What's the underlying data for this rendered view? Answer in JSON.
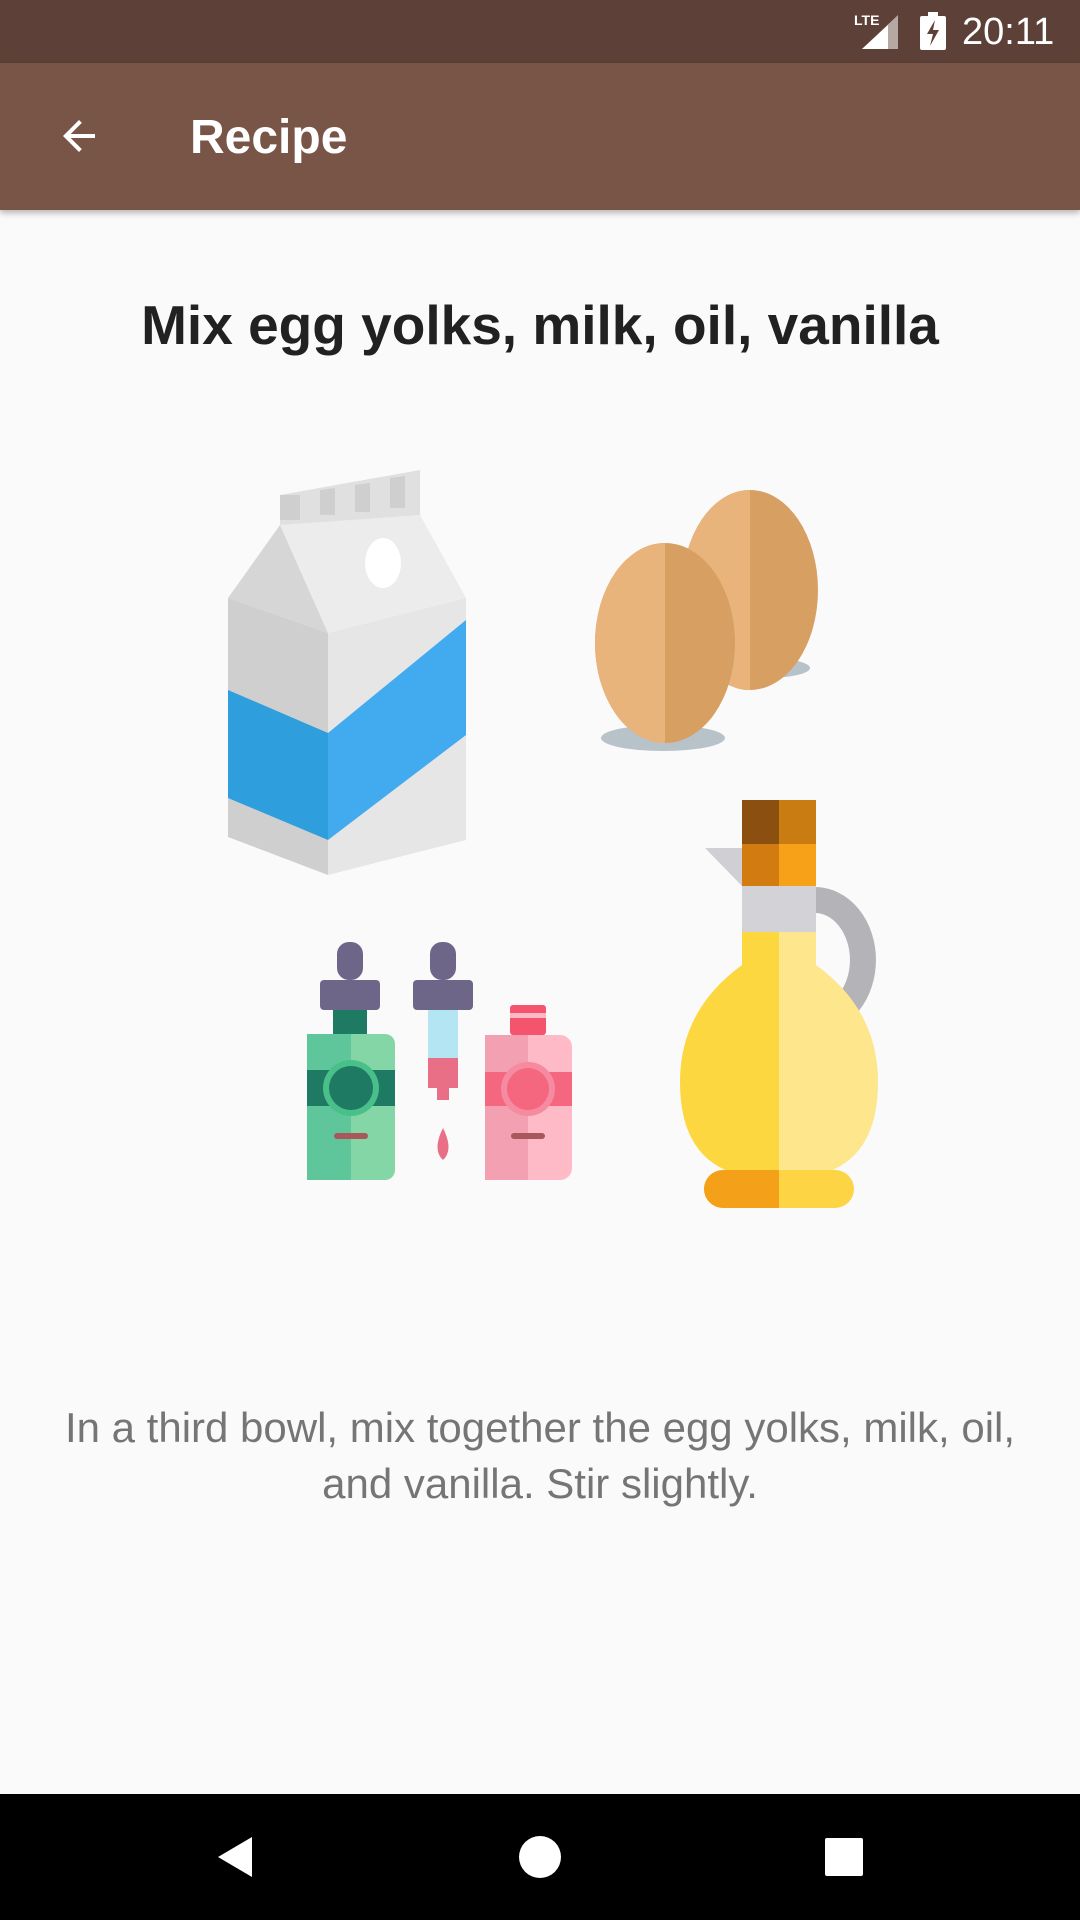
{
  "status_bar": {
    "network": "LTE",
    "time": "20:11",
    "icons": [
      "lte-signal-icon",
      "battery-charging-icon"
    ]
  },
  "app_bar": {
    "title": "Recipe",
    "back_icon": "arrow-back-icon"
  },
  "step": {
    "title": "Mix egg yolks, milk, oil, vanilla",
    "illustration_items": [
      "milk-carton",
      "eggs",
      "vanilla-extract-bottles",
      "oil-jar"
    ],
    "description": "In a third bowl, mix together the egg yolks, milk, oil, and vanilla. Stir slightly."
  },
  "nav_bar": {
    "icons": [
      "back-triangle-icon",
      "home-circle-icon",
      "recents-square-icon"
    ]
  },
  "colors": {
    "status_bar": "#5d4037",
    "app_bar": "#795548",
    "background": "#fafafa",
    "title_text": "#212121",
    "body_text": "#757575"
  }
}
